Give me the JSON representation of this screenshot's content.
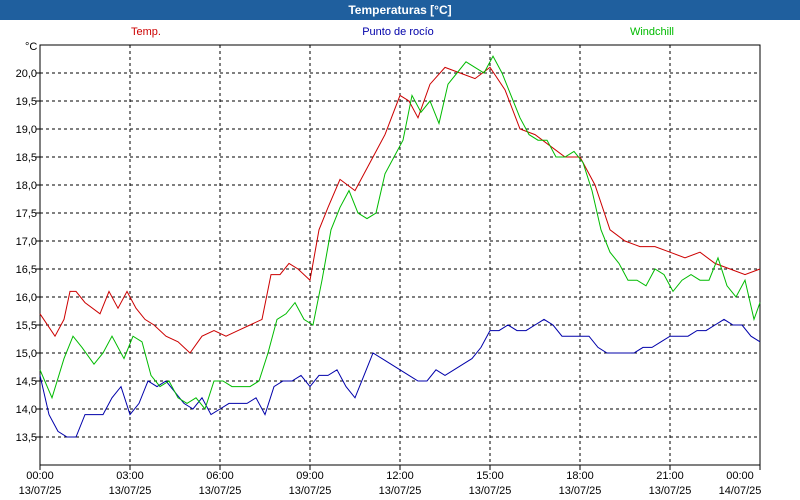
{
  "window": {
    "title": "Temperaturas [°C]"
  },
  "colors": {
    "temp": "#cc0000",
    "dew": "#0000aa",
    "windchill": "#00bb00",
    "frame": "#1f5f9e",
    "background": "#ffffff"
  },
  "chart_data": {
    "type": "line",
    "unit_label": "°C",
    "ylim": [
      13.0,
      20.5
    ],
    "y_ticks": [
      "13,5",
      "14,0",
      "14,5",
      "15,0",
      "15,5",
      "16,0",
      "16,5",
      "17,0",
      "17,5",
      "18,0",
      "18,5",
      "19,0",
      "19,5",
      "20,0"
    ],
    "xlim": [
      0,
      24
    ],
    "x_ticks": [
      {
        "time": "00:00",
        "date": "13/07/25"
      },
      {
        "time": "03:00",
        "date": "13/07/25"
      },
      {
        "time": "06:00",
        "date": "13/07/25"
      },
      {
        "time": "09:00",
        "date": "13/07/25"
      },
      {
        "time": "12:00",
        "date": "13/07/25"
      },
      {
        "time": "15:00",
        "date": "13/07/25"
      },
      {
        "time": "18:00",
        "date": "13/07/25"
      },
      {
        "time": "21:00",
        "date": "13/07/25"
      },
      {
        "time": "00:00",
        "date": "14/07/25"
      }
    ],
    "grid": true,
    "legend_placement": "top",
    "series": [
      {
        "name": "Temp.",
        "color": "#cc0000",
        "x": [
          0,
          0.5,
          0.8,
          1,
          1.2,
          1.5,
          2,
          2.3,
          2.6,
          2.9,
          3.2,
          3.5,
          3.8,
          4.2,
          4.6,
          5,
          5.4,
          5.8,
          6.2,
          6.6,
          7,
          7.4,
          7.7,
          8,
          8.3,
          8.6,
          9,
          9.3,
          9.6,
          10,
          10.5,
          11,
          11.5,
          12,
          12.3,
          12.6,
          13,
          13.5,
          14,
          14.5,
          15,
          15.5,
          16,
          16.5,
          17,
          17.5,
          18,
          18.5,
          19,
          19.5,
          20,
          20.5,
          21,
          21.5,
          22,
          22.5,
          23,
          23.5,
          24
        ],
        "y": [
          15.7,
          15.3,
          15.6,
          16.1,
          16.1,
          15.9,
          15.7,
          16.1,
          15.8,
          16.1,
          15.8,
          15.6,
          15.5,
          15.3,
          15.2,
          15.0,
          15.3,
          15.4,
          15.3,
          15.4,
          15.5,
          15.6,
          16.4,
          16.4,
          16.6,
          16.5,
          16.3,
          17.2,
          17.6,
          18.1,
          17.9,
          18.4,
          18.9,
          19.6,
          19.5,
          19.2,
          19.8,
          20.1,
          20.0,
          19.9,
          20.1,
          19.7,
          19.0,
          18.9,
          18.7,
          18.5,
          18.5,
          18.0,
          17.2,
          17.0,
          16.9,
          16.9,
          16.8,
          16.7,
          16.8,
          16.6,
          16.5,
          16.4,
          16.5
        ]
      },
      {
        "name": "Punto de rocío",
        "color": "#0000aa",
        "x": [
          0,
          0.3,
          0.6,
          0.9,
          1.2,
          1.5,
          1.8,
          2.1,
          2.4,
          2.7,
          3,
          3.3,
          3.6,
          3.9,
          4.2,
          4.5,
          4.8,
          5.1,
          5.4,
          5.7,
          6,
          6.3,
          6.6,
          6.9,
          7.2,
          7.5,
          7.8,
          8.1,
          8.4,
          8.7,
          9,
          9.3,
          9.6,
          9.9,
          10.2,
          10.5,
          10.8,
          11.1,
          11.4,
          11.7,
          12,
          12.3,
          12.6,
          12.9,
          13.2,
          13.5,
          13.8,
          14.1,
          14.4,
          14.7,
          15,
          15.3,
          15.6,
          15.9,
          16.2,
          16.5,
          16.8,
          17.1,
          17.4,
          17.7,
          18,
          18.3,
          18.6,
          18.9,
          19.2,
          19.5,
          19.8,
          20.1,
          20.4,
          20.7,
          21,
          21.3,
          21.6,
          21.9,
          22.2,
          22.5,
          22.8,
          23.1,
          23.4,
          23.7,
          24
        ],
        "y": [
          14.6,
          13.9,
          13.6,
          13.5,
          13.5,
          13.9,
          13.9,
          13.9,
          14.2,
          14.4,
          13.9,
          14.1,
          14.5,
          14.4,
          14.5,
          14.3,
          14.1,
          14.0,
          14.2,
          13.9,
          14.0,
          14.1,
          14.1,
          14.1,
          14.2,
          13.9,
          14.4,
          14.5,
          14.5,
          14.6,
          14.4,
          14.6,
          14.6,
          14.7,
          14.4,
          14.2,
          14.6,
          15.0,
          14.9,
          14.8,
          14.7,
          14.6,
          14.5,
          14.5,
          14.7,
          14.6,
          14.7,
          14.8,
          14.9,
          15.1,
          15.4,
          15.4,
          15.5,
          15.4,
          15.4,
          15.5,
          15.6,
          15.5,
          15.3,
          15.3,
          15.3,
          15.3,
          15.1,
          15.0,
          15.0,
          15.0,
          15.0,
          15.1,
          15.1,
          15.2,
          15.3,
          15.3,
          15.3,
          15.4,
          15.4,
          15.5,
          15.6,
          15.5,
          15.5,
          15.3,
          15.2
        ]
      },
      {
        "name": "Windchill",
        "color": "#00bb00",
        "x": [
          0,
          0.4,
          0.8,
          1.1,
          1.4,
          1.8,
          2.1,
          2.4,
          2.8,
          3.1,
          3.4,
          3.7,
          4,
          4.3,
          4.6,
          4.9,
          5.2,
          5.5,
          5.8,
          6.1,
          6.4,
          6.7,
          7,
          7.3,
          7.6,
          7.9,
          8.2,
          8.5,
          8.8,
          9.1,
          9.4,
          9.7,
          10,
          10.3,
          10.6,
          10.9,
          11.2,
          11.5,
          11.8,
          12.1,
          12.4,
          12.7,
          13,
          13.3,
          13.6,
          13.9,
          14.2,
          14.5,
          14.8,
          15.1,
          15.4,
          15.7,
          16,
          16.3,
          16.6,
          16.9,
          17.2,
          17.5,
          17.8,
          18.1,
          18.4,
          18.7,
          19,
          19.3,
          19.6,
          19.9,
          20.2,
          20.5,
          20.8,
          21.1,
          21.4,
          21.7,
          22,
          22.3,
          22.6,
          22.9,
          23.2,
          23.5,
          23.8,
          24
        ],
        "y": [
          14.7,
          14.2,
          14.9,
          15.3,
          15.1,
          14.8,
          15.0,
          15.3,
          14.9,
          15.3,
          15.2,
          14.6,
          14.4,
          14.5,
          14.2,
          14.1,
          14.2,
          14.0,
          14.5,
          14.5,
          14.4,
          14.4,
          14.4,
          14.5,
          15.0,
          15.6,
          15.7,
          15.9,
          15.6,
          15.5,
          16.3,
          17.2,
          17.6,
          17.9,
          17.5,
          17.4,
          17.5,
          18.2,
          18.5,
          18.8,
          19.6,
          19.3,
          19.5,
          19.1,
          19.8,
          20.0,
          20.2,
          20.1,
          20.0,
          20.3,
          20.0,
          19.6,
          19.2,
          18.9,
          18.8,
          18.8,
          18.5,
          18.5,
          18.6,
          18.4,
          17.9,
          17.2,
          16.8,
          16.6,
          16.3,
          16.3,
          16.2,
          16.5,
          16.4,
          16.1,
          16.3,
          16.4,
          16.3,
          16.3,
          16.7,
          16.2,
          16.0,
          16.3,
          15.6,
          15.9
        ]
      }
    ]
  }
}
